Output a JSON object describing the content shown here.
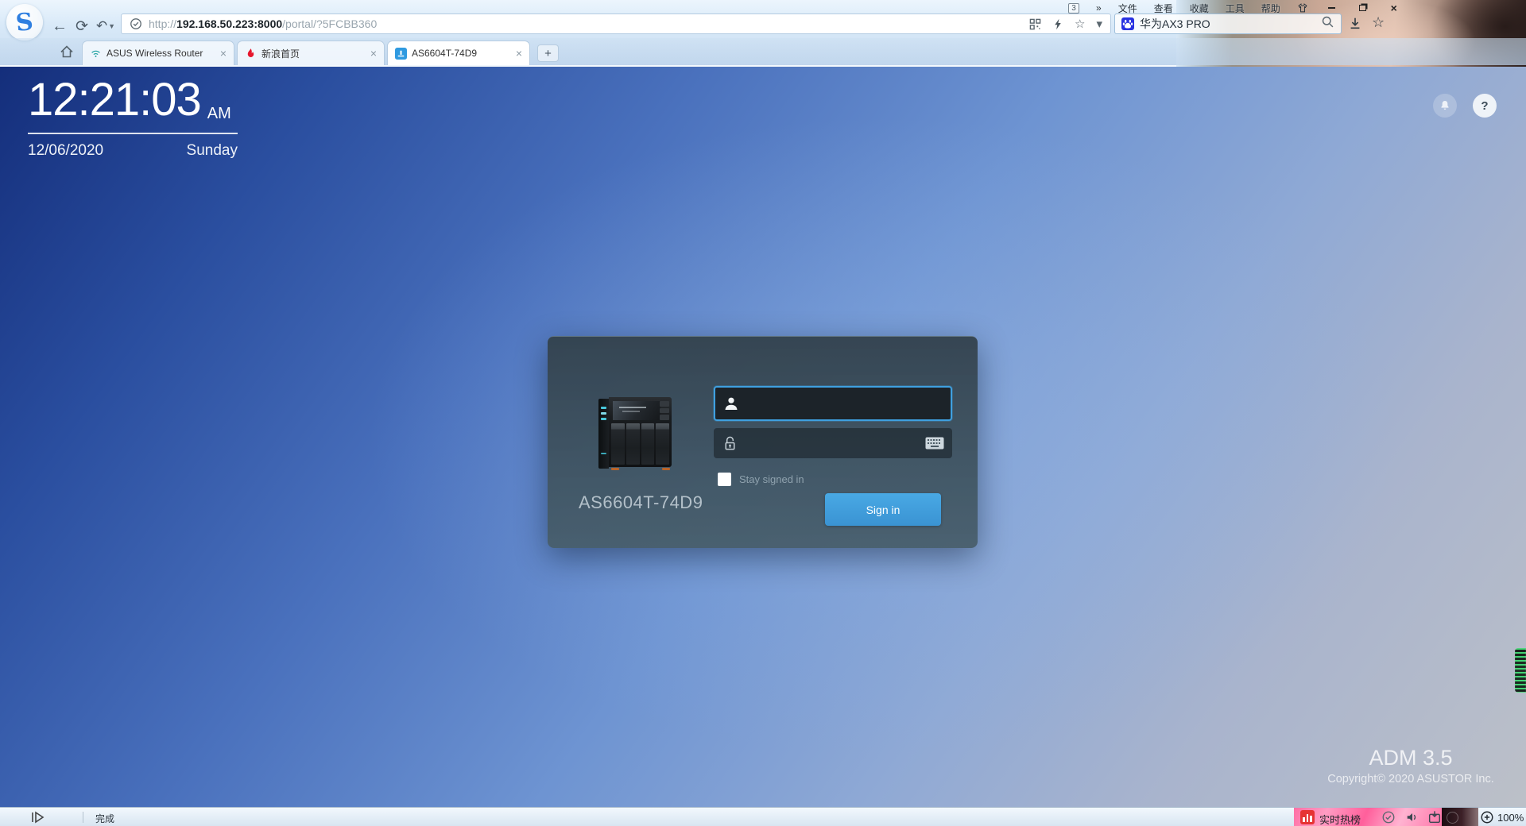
{
  "colors": {
    "accent_blue": "#3f9fdc",
    "page_gradient_top": "#142e7b",
    "page_gradient_bottom": "#bcc0c8",
    "dialog_bg": "#3c4f5b",
    "sina_red": "#e6162d",
    "wifi_teal": "#1a9f9f",
    "baidu_blue": "#2932e1",
    "hot_list_red": "#e63333",
    "gadget_green": "#46dc78"
  },
  "browser_chrome": {
    "window_badge": "3",
    "overflow_glyph": "»",
    "menu_items": [
      "文件",
      "查看",
      "收藏",
      "工具",
      "帮助"
    ],
    "close_glyph": "×",
    "address": {
      "scheme": "http://",
      "host": "192.168.50.223:8000",
      "path": "/portal/?5FCBB360"
    },
    "search_query": "华为AX3 PRO",
    "tabs": [
      {
        "label": "ASUS Wireless Router"
      },
      {
        "label": "新浪首页"
      },
      {
        "label": "AS6604T-74D9"
      }
    ],
    "tab_close_glyph": "×",
    "new_tab_glyph": "+",
    "caret_glyph": "▾",
    "bookmark_star_glyph": "☆"
  },
  "adm_page": {
    "clock": {
      "time": "12:21:03",
      "meridiem": "AM",
      "date": "12/06/2020",
      "weekday": "Sunday"
    },
    "help_glyph": "?",
    "login": {
      "device_model": "AS6604T-74D9",
      "username_value": "",
      "password_value": "",
      "stay_signed_in": "Stay signed in",
      "sign_in": "Sign in"
    },
    "footer": {
      "version": "ADM 3.5",
      "copyright": "Copyright© 2020 ASUSTOR Inc."
    }
  },
  "status_bar": {
    "status_text": "完成",
    "hot_list": "实时热榜",
    "zoom": "100%"
  }
}
